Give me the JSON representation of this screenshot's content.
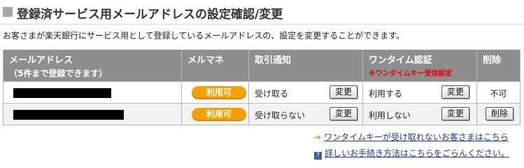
{
  "header": {
    "title": "登録済サービス用メールアドレスの設定確認/変更"
  },
  "description": "お客さまが楽天銀行にサービス用として登録しているメールアドレスの、設定を変更することができます。",
  "table": {
    "headers": {
      "email": "メールアドレス",
      "email_sub": "（5件まで登録できます）",
      "mailmag": "メルマネ",
      "transaction": "取引通知",
      "onetime": "ワンタイム認証",
      "onetime_note": "※ワンタイムキー受信設定",
      "delete": "削除"
    },
    "rows": [
      {
        "email": "[redacted]",
        "mailmag_badge": "利用可",
        "transaction_status": "受け取る",
        "transaction_button": "変更",
        "onetime_status": "利用する",
        "onetime_button": "変更",
        "delete_text": "不可"
      },
      {
        "email": "[redacted]",
        "mailmag_badge": "利用可",
        "transaction_status": "受け取らない",
        "transaction_button": "変更",
        "onetime_status": "利用しない",
        "onetime_button": "変更",
        "delete_button": "削除"
      }
    ]
  },
  "links": {
    "onetime_help": "ワンタイムキーが受け取れないお客さまはこちら",
    "procedure_help": "詳しいお手続き方法はこちらをごらんください。"
  },
  "colors": {
    "badge": "#f6a100",
    "header_bg": "#8e8e8e",
    "note_red": "#e60012",
    "link": "#1a3c8c"
  }
}
